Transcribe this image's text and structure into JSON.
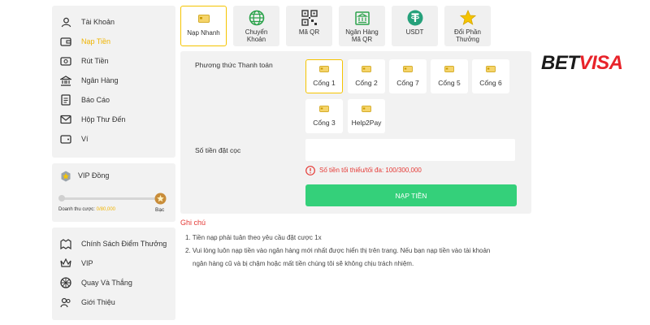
{
  "sidebar": {
    "menu": [
      {
        "label": "Tài Khoản",
        "icon": "user-icon",
        "active": false
      },
      {
        "label": "Nạp Tiền",
        "icon": "wallet-icon",
        "active": true
      },
      {
        "label": "Rút Tiền",
        "icon": "withdraw-icon",
        "active": false
      },
      {
        "label": "Ngân Hàng",
        "icon": "bank-icon",
        "active": false
      },
      {
        "label": "Báo Cáo",
        "icon": "report-icon",
        "active": false
      },
      {
        "label": "Hộp Thư Đến",
        "icon": "inbox-icon",
        "active": false
      },
      {
        "label": "Ví",
        "icon": "purse-icon",
        "active": false
      }
    ],
    "vip": {
      "level": "VIP Đồng",
      "revenue_label": "Doanh thu cược:",
      "revenue_value": "0/80,000",
      "next_level": "Bạc",
      "progress": 0
    },
    "bottom_menu": [
      {
        "label": "Chính Sách Điểm Thưởng",
        "icon": "policy-icon"
      },
      {
        "label": "VIP",
        "icon": "crown-icon"
      },
      {
        "label": "Quay Và Thắng",
        "icon": "wheel-icon"
      },
      {
        "label": "Giới Thiệu",
        "icon": "referral-icon"
      }
    ]
  },
  "tabs": [
    {
      "label": "Nạp Nhanh",
      "icon": "card-icon",
      "active": true
    },
    {
      "label": "Chuyển Khoản",
      "icon": "globe-icon",
      "active": false
    },
    {
      "label": "Mã QR",
      "icon": "qr-icon",
      "active": false
    },
    {
      "label": "Ngân Hàng Mã QR",
      "icon": "bank-qr-icon",
      "active": false
    },
    {
      "label": "USDT",
      "icon": "tether-icon",
      "active": false
    },
    {
      "label": "Đổi Phần Thưởng",
      "icon": "star-icon",
      "active": false
    }
  ],
  "form": {
    "payment_method_label": "Phương thức Thanh toán",
    "gates": [
      {
        "label": "Cổng 1",
        "active": true
      },
      {
        "label": "Cổng 2",
        "active": false
      },
      {
        "label": "Cổng 7",
        "active": false
      },
      {
        "label": "Cổng 5",
        "active": false
      },
      {
        "label": "Cổng 6",
        "active": false
      },
      {
        "label": "Cổng 3",
        "active": false
      },
      {
        "label": "Help2Pay",
        "active": false
      }
    ],
    "amount_label": "Số tiền đặt cọc",
    "amount_value": "",
    "hint": "Số tiền tối thiểu/tối đa: 100/300,000",
    "submit_label": "NẠP TIỀN"
  },
  "notes": {
    "title": "Ghi chú",
    "items": [
      "1. Tiền nạp phải tuân theo yêu cầu đặt cược 1x",
      "2. Vui lòng luôn nạp tiền vào ngân hàng mới nhất được hiển thị trên trang. Nếu bạn nạp tiền vào tài khoản",
      "ngân hàng cũ và bị chậm hoặc mất tiền chúng tôi sẽ không chịu trách nhiệm."
    ]
  },
  "brand": {
    "part1": "BET",
    "part2": "VISA"
  },
  "colors": {
    "accent": "#f5c400",
    "green": "#34d07a",
    "error": "#e53935",
    "brand_red": "#e8232a"
  }
}
